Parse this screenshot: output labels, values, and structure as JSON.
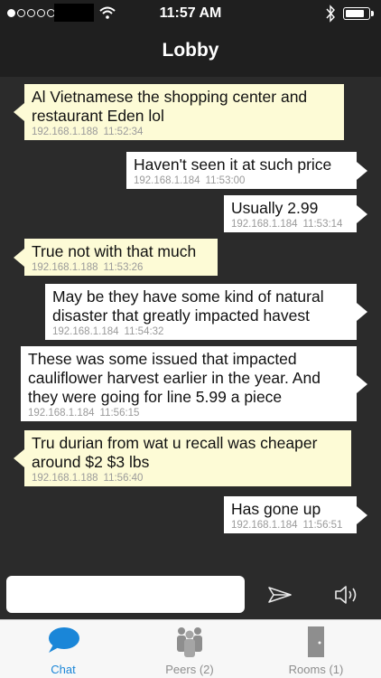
{
  "status_bar": {
    "time": "11:57 AM",
    "signal_dots_filled": 1,
    "signal_dots_total": 5,
    "battery_level": 0.85,
    "icons": [
      "wifi-icon",
      "bluetooth-icon",
      "battery-icon"
    ]
  },
  "nav": {
    "title": "Lobby"
  },
  "colors": {
    "incoming_bubble": "#fdfbd6",
    "outgoing_bubble": "#ffffff",
    "active_tab": "#1a86d8",
    "background": "#2b2b2b"
  },
  "messages": [
    {
      "direction": "incoming",
      "text": "Al Vietnamese the shopping center and\nrestaurant Eden lol",
      "ip": "192.168.1.188",
      "time": "11:52:34"
    },
    {
      "direction": "outgoing",
      "text": "Haven't seen it at such price",
      "ip": "192.168.1.184",
      "time": "11:53:00"
    },
    {
      "direction": "outgoing",
      "text": "Usually 2.99",
      "ip": "192.168.1.184",
      "time": "11:53:14"
    },
    {
      "direction": "incoming",
      "text": "True not with that much",
      "ip": "192.168.1.188",
      "time": "11:53:26"
    },
    {
      "direction": "outgoing",
      "text": "May be they have some kind of natural\ndisaster that greatly impacted havest",
      "ip": "192.168.1.184",
      "time": "11:54:32"
    },
    {
      "direction": "outgoing",
      "text": "These was some issued that impacted\ncauliflower harvest earlier in the year. And\nthey were going for line 5.99 a piece",
      "ip": "192.168.1.184",
      "time": "11:56:15"
    },
    {
      "direction": "incoming",
      "text": "Tru durian from wat u recall was cheaper\naround $2 $3 lbs",
      "ip": "192.168.1.188",
      "time": "11:56:40"
    },
    {
      "direction": "outgoing",
      "text": "Has gone up",
      "ip": "192.168.1.184",
      "time": "11:56:51"
    }
  ],
  "compose": {
    "placeholder": "",
    "value": ""
  },
  "tabs": [
    {
      "label": "Chat",
      "icon": "chat-bubble-icon",
      "active": true
    },
    {
      "label": "Peers (2)",
      "icon": "peers-icon",
      "active": false
    },
    {
      "label": "Rooms (1)",
      "icon": "door-icon",
      "active": false
    }
  ]
}
